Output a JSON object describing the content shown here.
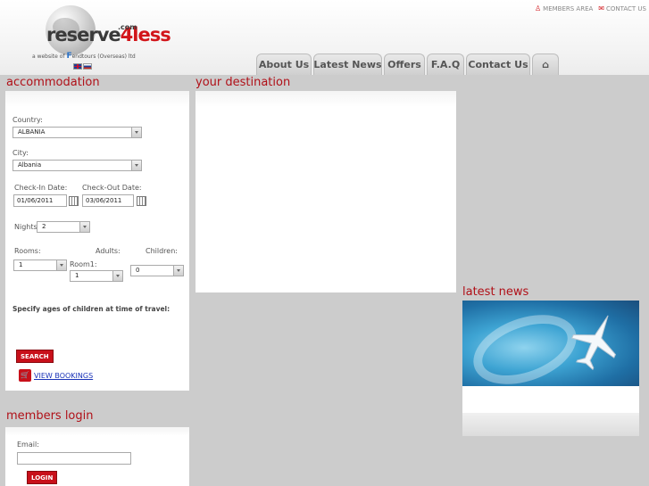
{
  "header": {
    "logo_main": "reserve",
    "logo_accent": "4less",
    "logo_com": ".com",
    "tagline_prefix": "a website of",
    "tagline_brand": "F",
    "tagline_suffix": "endtours (Overseas) ltd",
    "top_links": [
      {
        "label": "MEMBERS AREA",
        "icon": "members-icon"
      },
      {
        "label": "CONTACT US",
        "icon": "contact-icon"
      }
    ],
    "languages": [
      "en-flag",
      "ru-flag"
    ]
  },
  "nav": {
    "tabs": [
      "About Us",
      "Latest News",
      "Offers",
      "F.A.Q",
      "Contact Us"
    ],
    "home_icon": "⌂"
  },
  "accommodation": {
    "title": "accommodation",
    "country_label": "Country:",
    "country_value": "ALBANIA",
    "city_label": "City:",
    "city_value": "Albania",
    "checkin_label": "Check-In Date:",
    "checkin_value": "01/06/2011",
    "checkout_label": "Check-Out Date:",
    "checkout_value": "03/06/2011",
    "nights_label": "Nights:",
    "nights_value": "2",
    "rooms_label": "Rooms:",
    "rooms_value": "1",
    "adults_label": "Adults:",
    "room1_label": "Room1:",
    "adults_value": "1",
    "children_label": "Children:",
    "children_value": "0",
    "ages_note": "Specify ages of children at time of travel:",
    "search_label": "SEARCH",
    "view_bookings_label": "VIEW BOOKINGS"
  },
  "destination": {
    "title": "your destination"
  },
  "latest_news": {
    "title": "latest news"
  },
  "members_login": {
    "title": "members login",
    "email_label": "Email:",
    "email_value": "",
    "login_label": "LOGIN"
  },
  "colors": {
    "accent": "#b01018",
    "button": "#c8101a",
    "background": "#cccccc"
  }
}
